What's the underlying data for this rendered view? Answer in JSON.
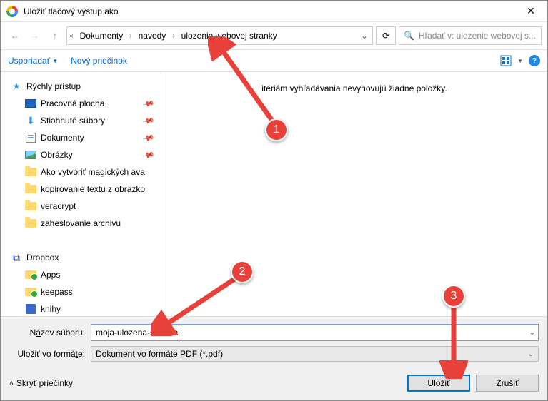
{
  "window": {
    "title": "Uložiť tlačový výstup ako"
  },
  "breadcrumb": {
    "items": [
      "Dokumenty",
      "navody",
      "ulozenie webovej stranky"
    ]
  },
  "search": {
    "placeholder": "Hľadať v: ulozenie webovej s..."
  },
  "toolbar": {
    "organize": "Usporiadať",
    "newfolder": "Nový priečinok"
  },
  "sidebar": {
    "quick": "Rýchly prístup",
    "items": [
      {
        "label": "Pracovná plocha",
        "pin": true
      },
      {
        "label": "Stiahnuté súbory",
        "pin": true
      },
      {
        "label": "Dokumenty",
        "pin": true
      },
      {
        "label": "Obrázky",
        "pin": true
      },
      {
        "label": "Ako vytvoriť magických ava"
      },
      {
        "label": "kopirovanie textu z obrazko"
      },
      {
        "label": "veracrypt"
      },
      {
        "label": "zaheslovanie archivu"
      }
    ],
    "dropbox": "Dropbox",
    "dbx_items": [
      {
        "label": "Apps"
      },
      {
        "label": "keepass"
      },
      {
        "label": "knihy"
      }
    ]
  },
  "content": {
    "empty": "itériám vyhľadávania nevyhovujú žiadne položky."
  },
  "form": {
    "filename_label_pre": "N",
    "filename_label_u": "á",
    "filename_label_post": "zov súboru:",
    "filename_value": "moja-ulozena-stranka",
    "filetype_label_pre": "Uložiť vo formá",
    "filetype_label_u": "t",
    "filetype_label_post": "e:",
    "filetype_value": "Dokument vo formáte PDF (*.pdf)"
  },
  "buttons": {
    "hide": "Skryť priečinky",
    "save": "Uložiť",
    "cancel": "Zrušiť"
  },
  "markers": {
    "a": "1",
    "b": "2",
    "c": "3"
  }
}
